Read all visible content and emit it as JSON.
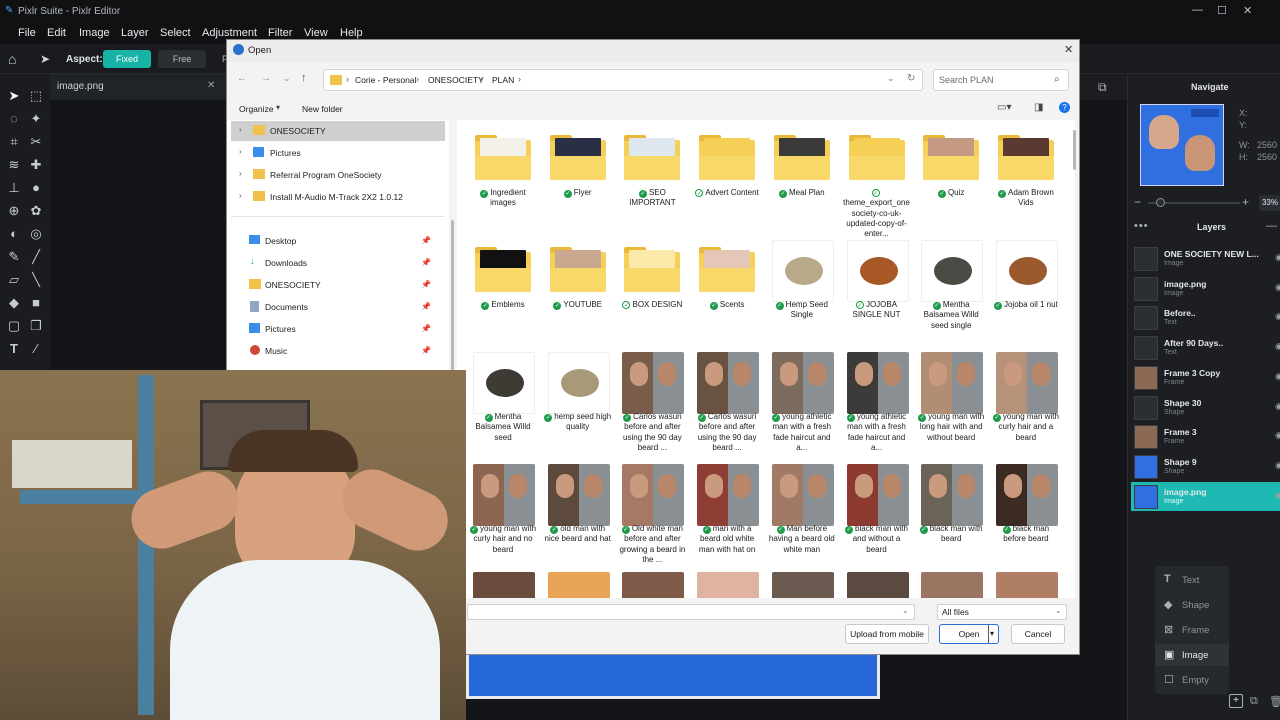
{
  "app": {
    "title": "Pixlr Suite - Pixlr Editor"
  },
  "menu": [
    "File",
    "Edit",
    "Image",
    "Layer",
    "Select",
    "Adjustment",
    "Filter",
    "View",
    "Help"
  ],
  "toolbar": {
    "aspect_label": "Aspect:",
    "fixed": "Fixed",
    "free": "Free",
    "cut_label": "F"
  },
  "file_tab": {
    "name": "image.png"
  },
  "navigate": {
    "title": "Navigate",
    "x": "X:",
    "y": "Y:",
    "w": "W:",
    "h": "H:",
    "wval": "2560",
    "hval": "2560",
    "zoom": "33%"
  },
  "layers": {
    "title": "Layers",
    "items": [
      {
        "name": "ONE SOCIETY NEW L...",
        "type": "Image"
      },
      {
        "name": "image.png",
        "type": "Image"
      },
      {
        "name": "Before..",
        "type": "Text"
      },
      {
        "name": "After 90 Days..",
        "type": "Text"
      },
      {
        "name": "Frame 3 Copy",
        "type": "Frame"
      },
      {
        "name": "Shape 30",
        "type": "Shape"
      },
      {
        "name": "Frame 3",
        "type": "Frame"
      },
      {
        "name": "Shape 9",
        "type": "Shape"
      },
      {
        "name": "image.png",
        "type": "Image",
        "selected": true
      }
    ]
  },
  "add_menu": [
    {
      "label": "Text",
      "icon": "text-icon"
    },
    {
      "label": "Shape",
      "icon": "shape-icon"
    },
    {
      "label": "Frame",
      "icon": "frame-icon"
    },
    {
      "label": "Image",
      "icon": "image-icon"
    },
    {
      "label": "Empty",
      "icon": "empty-icon"
    }
  ],
  "dialog": {
    "title": "Open",
    "breadcrumb": [
      "Corie - Personal",
      "ONESOCIETY",
      "PLAN"
    ],
    "search_placeholder": "Search PLAN",
    "organize": "Organize",
    "new_folder": "New folder",
    "nav_tree": [
      "ONESOCIETY",
      "Pictures",
      "Referral Program OneSociety",
      "Install M-Audio M-Track 2X2 1.0.12"
    ],
    "quick_access": [
      "Desktop",
      "Downloads",
      "ONESOCIETY",
      "Documents",
      "Pictures",
      "Music"
    ],
    "files": [
      {
        "name": "Ingredient images",
        "kind": "folder",
        "status": "green"
      },
      {
        "name": "Flyer",
        "kind": "folder",
        "status": "green"
      },
      {
        "name": "SEO IMPORTANT",
        "kind": "folder",
        "status": "green"
      },
      {
        "name": "Advert Content",
        "kind": "folder",
        "status": "outline"
      },
      {
        "name": "Meal Plan",
        "kind": "folder",
        "status": "green"
      },
      {
        "name": "theme_export_onesociety-co-uk-updated-copy-of-enter...",
        "kind": "folder",
        "status": "outline"
      },
      {
        "name": "Quiz",
        "kind": "folder",
        "status": "green"
      },
      {
        "name": "Adam Brown Vids",
        "kind": "folder",
        "status": "green"
      },
      {
        "name": "Emblems",
        "kind": "folder",
        "status": "green"
      },
      {
        "name": "YOUTUBE",
        "kind": "folder",
        "status": "green"
      },
      {
        "name": "BOX DESIGN",
        "kind": "folder",
        "status": "outline"
      },
      {
        "name": "Scents",
        "kind": "folder",
        "status": "green"
      },
      {
        "name": "Hemp Seed Single",
        "kind": "image",
        "status": "green"
      },
      {
        "name": "JOJOBA SINGLE NUT",
        "kind": "image",
        "status": "outline"
      },
      {
        "name": "Mentha Balsamea Willd seed single",
        "kind": "image",
        "status": "green"
      },
      {
        "name": "Jojoba oil 1 nut",
        "kind": "image",
        "status": "green"
      },
      {
        "name": "Mentha Balsamea Willd seed",
        "kind": "image",
        "status": "green"
      },
      {
        "name": "hemp seed high quality",
        "kind": "image",
        "status": "green"
      },
      {
        "name": "Carlos wasuri before and after using the 90 day beard ...",
        "kind": "image",
        "status": "green"
      },
      {
        "name": "Carlos wasuri before and after using the 90 day beard ...",
        "kind": "image",
        "status": "green"
      },
      {
        "name": "young athletic man with a fresh fade haircut and a...",
        "kind": "image",
        "status": "green"
      },
      {
        "name": "young athletic man with a fresh fade haircut and a...",
        "kind": "image",
        "status": "green"
      },
      {
        "name": "young man with long hair with and without beard",
        "kind": "image",
        "status": "green"
      },
      {
        "name": "young man with curly hair and a beard",
        "kind": "image",
        "status": "green"
      },
      {
        "name": "young man with curly hair and no beard",
        "kind": "image",
        "status": "green"
      },
      {
        "name": "old man with nice beard and hat",
        "kind": "image",
        "status": "green"
      },
      {
        "name": "Old white man before and after growing a beard in the ...",
        "kind": "image",
        "status": "green"
      },
      {
        "name": "man with a beard old white man with hat on",
        "kind": "image",
        "status": "green"
      },
      {
        "name": "Man before having a beard old white man",
        "kind": "image",
        "status": "green"
      },
      {
        "name": "black man with and without a beard",
        "kind": "image",
        "status": "green"
      },
      {
        "name": "black man with beard",
        "kind": "image",
        "status": "green"
      },
      {
        "name": "black man before beard",
        "kind": "image",
        "status": "green"
      }
    ],
    "filter": "All files",
    "upload": "Upload from mobile",
    "open": "Open",
    "cancel": "Cancel"
  },
  "colors": {
    "accent": "#17b3a6",
    "selected_layer": "#1fb9b4",
    "canvas_blue": "#2668d8",
    "folder": "#f6cf57"
  }
}
